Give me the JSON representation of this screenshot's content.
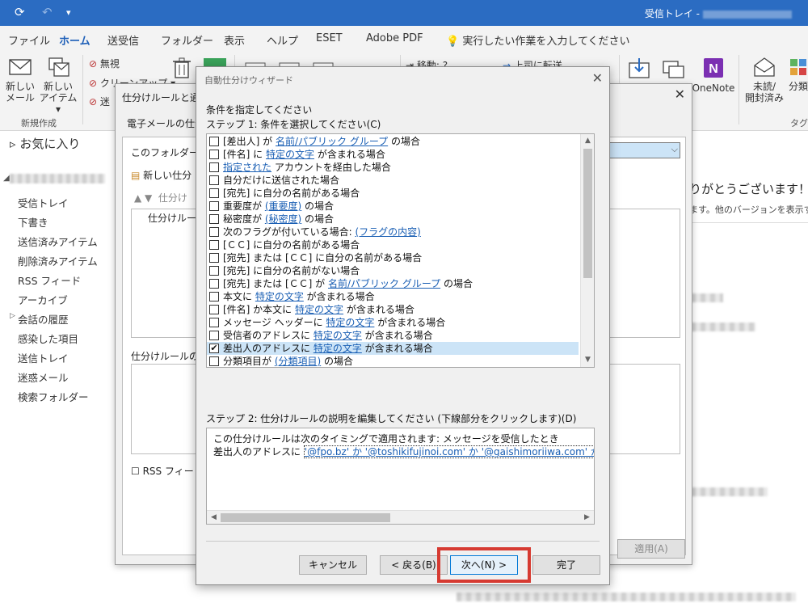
{
  "titlebar": {
    "title": "受信トレイ -"
  },
  "tabs": [
    "ファイル",
    "ホーム",
    "送受信",
    "フォルダー",
    "表示",
    "ヘルプ",
    "ESET",
    "Adobe PDF"
  ],
  "tell_me": "実行したい作業を入力してください",
  "ribbon": {
    "new_mail": [
      "新しい",
      "メール"
    ],
    "new_items": [
      "新しい",
      "アイテム"
    ],
    "group_new": "新規作成",
    "ignore": "無視",
    "cleanup": "クリーンアップ",
    "junk_partial": "迷",
    "move_partial": "移動: ?",
    "forward_partial": "上司に転送",
    "onenote": "OneNote",
    "unread": [
      "未読/",
      "開封済み"
    ],
    "categorize": "分類",
    "group_tags": "タグ"
  },
  "nav": {
    "favorites": "お気に入り",
    "items": [
      "受信トレイ",
      "下書き",
      "送信済みアイテム",
      "削除済みアイテム",
      "RSS フィード",
      "アーカイブ",
      "会話の履歴",
      "感染した項目",
      "送信トレイ",
      "迷惑メール",
      "検索フォルダー"
    ]
  },
  "reading": {
    "thanks": "りがとうございます！",
    "versions": "ます。他のバージョンを表示する"
  },
  "rules_dialog": {
    "title": "仕分けルールと通知",
    "tab": "電子メールの仕分",
    "folder_label": "このフォルダーに変",
    "new_rule": "新しい仕分",
    "change_rule": "仕分け",
    "col_header": "仕分けルール",
    "desc_label": "仕分けルールの説",
    "rss_check": "RSS フィード",
    "apply": "適用(A)"
  },
  "wizard": {
    "title": "自動仕分けウィザード",
    "prompt": "条件を指定してください",
    "step1": "ステップ 1: 条件を選択してください(C)",
    "conditions": [
      {
        "checked": false,
        "parts": [
          [
            "t",
            "[差出人] が "
          ],
          [
            "l",
            "名前/パブリック グループ"
          ],
          [
            "t",
            " の場合"
          ]
        ]
      },
      {
        "checked": false,
        "parts": [
          [
            "t",
            "[件名] に "
          ],
          [
            "l",
            "特定の文字"
          ],
          [
            "t",
            " が含まれる場合"
          ]
        ]
      },
      {
        "checked": false,
        "parts": [
          [
            "l",
            "指定された"
          ],
          [
            "t",
            " アカウントを経由した場合"
          ]
        ]
      },
      {
        "checked": false,
        "parts": [
          [
            "t",
            "自分だけに送信された場合"
          ]
        ]
      },
      {
        "checked": false,
        "parts": [
          [
            "t",
            "[宛先] に自分の名前がある場合"
          ]
        ]
      },
      {
        "checked": false,
        "parts": [
          [
            "t",
            "重要度が "
          ],
          [
            "l",
            "(重要度)"
          ],
          [
            "t",
            " の場合"
          ]
        ]
      },
      {
        "checked": false,
        "parts": [
          [
            "t",
            "秘密度が "
          ],
          [
            "l",
            "(秘密度)"
          ],
          [
            "t",
            " の場合"
          ]
        ]
      },
      {
        "checked": false,
        "parts": [
          [
            "t",
            "次のフラグが付いている場合: "
          ],
          [
            "l",
            "(フラグの内容)"
          ]
        ]
      },
      {
        "checked": false,
        "parts": [
          [
            "t",
            "[ＣＣ] に自分の名前がある場合"
          ]
        ]
      },
      {
        "checked": false,
        "parts": [
          [
            "t",
            "[宛先] または [ＣＣ] に自分の名前がある場合"
          ]
        ]
      },
      {
        "checked": false,
        "parts": [
          [
            "t",
            "[宛先] に自分の名前がない場合"
          ]
        ]
      },
      {
        "checked": false,
        "parts": [
          [
            "t",
            "[宛先] または [ＣＣ] が "
          ],
          [
            "l",
            "名前/パブリック グループ"
          ],
          [
            "t",
            " の場合"
          ]
        ]
      },
      {
        "checked": false,
        "parts": [
          [
            "t",
            "本文に "
          ],
          [
            "l",
            "特定の文字"
          ],
          [
            "t",
            " が含まれる場合"
          ]
        ]
      },
      {
        "checked": false,
        "parts": [
          [
            "t",
            "[件名] か本文に "
          ],
          [
            "l",
            "特定の文字"
          ],
          [
            "t",
            " が含まれる場合"
          ]
        ]
      },
      {
        "checked": false,
        "parts": [
          [
            "t",
            "メッセージ ヘッダーに "
          ],
          [
            "l",
            "特定の文字"
          ],
          [
            "t",
            " が含まれる場合"
          ]
        ]
      },
      {
        "checked": false,
        "parts": [
          [
            "t",
            "受信者のアドレスに "
          ],
          [
            "l",
            "特定の文字"
          ],
          [
            "t",
            " が含まれる場合"
          ]
        ]
      },
      {
        "checked": true,
        "selected": true,
        "parts": [
          [
            "t",
            "差出人のアドレスに "
          ],
          [
            "l",
            "特定の文字"
          ],
          [
            "t",
            " が含まれる場合"
          ]
        ]
      },
      {
        "checked": false,
        "parts": [
          [
            "t",
            "分類項目が "
          ],
          [
            "l",
            "(分類項目)"
          ],
          [
            "t",
            " の場合"
          ]
        ]
      }
    ],
    "step2": "ステップ 2: 仕分けルールの説明を編集してください (下線部分をクリックします)(D)",
    "desc_line1": "この仕分けルールは次のタイミングで適用されます: メッセージを受信したとき",
    "desc_line2_prefix": "差出人のアドレスに ",
    "desc_line2_link": "'@fpo.bz' か '@toshikifujinoi.com' か '@gaishimoriiwa.com' か '@a",
    "buttons": {
      "cancel": "キャンセル",
      "back": "< 戻る(B)",
      "next": "次へ(N) >",
      "finish": "完了"
    }
  },
  "colors": {
    "accent": "#2b6cc2",
    "highlight": "#d63a31",
    "link": "#1a5fb4",
    "selected_row": "#cce4f7"
  }
}
